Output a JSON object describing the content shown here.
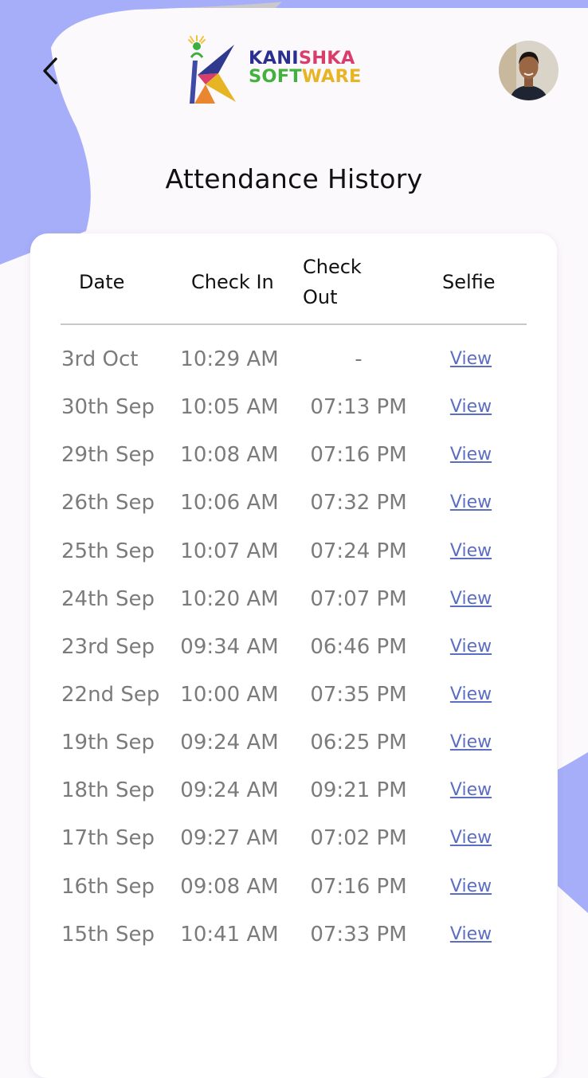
{
  "header": {
    "back_icon": "chevron-left-icon",
    "logo": {
      "line1_part1": "KANI",
      "line1_part2": "SHKA",
      "line2_part1": "SOFT",
      "line2_part2": "WARE"
    },
    "avatar": "profile-photo"
  },
  "page": {
    "title": "Attendance History"
  },
  "table": {
    "headers": {
      "date": "Date",
      "check_in": "Check In",
      "check_out": "Check Out",
      "selfie": "Selfie"
    },
    "rows": [
      {
        "date": "3rd Oct",
        "check_in": "10:29 AM",
        "check_out": "-",
        "selfie": "View"
      },
      {
        "date": "30th Sep",
        "check_in": "10:05 AM",
        "check_out": "07:13 PM",
        "selfie": "View"
      },
      {
        "date": "29th Sep",
        "check_in": "10:08 AM",
        "check_out": "07:16 PM",
        "selfie": "View"
      },
      {
        "date": "26th Sep",
        "check_in": "10:06 AM",
        "check_out": "07:32 PM",
        "selfie": "View"
      },
      {
        "date": "25th Sep",
        "check_in": "10:07 AM",
        "check_out": "07:24 PM",
        "selfie": "View"
      },
      {
        "date": "24th Sep",
        "check_in": "10:20 AM",
        "check_out": "07:07 PM",
        "selfie": "View"
      },
      {
        "date": "23rd Sep",
        "check_in": "09:34 AM",
        "check_out": "06:46 PM",
        "selfie": "View"
      },
      {
        "date": "22nd Sep",
        "check_in": "10:00 AM",
        "check_out": "07:35 PM",
        "selfie": "View"
      },
      {
        "date": "19th Sep",
        "check_in": "09:24 AM",
        "check_out": "06:25 PM",
        "selfie": "View"
      },
      {
        "date": "18th Sep",
        "check_in": "09:24 AM",
        "check_out": "09:21 PM",
        "selfie": "View"
      },
      {
        "date": "17th Sep",
        "check_in": "09:27 AM",
        "check_out": "07:02 PM",
        "selfie": "View"
      },
      {
        "date": "16th Sep",
        "check_in": "09:08 AM",
        "check_out": "07:16 PM",
        "selfie": "View"
      },
      {
        "date": "15th Sep",
        "check_in": "10:41 AM",
        "check_out": "07:33 PM",
        "selfie": "View"
      }
    ]
  },
  "colors": {
    "background": "#fcf9fd",
    "blob": "#a6aefa",
    "card": "#ffffff",
    "link": "#5b6ec2",
    "row_text": "#7b7b7b",
    "header_text": "#111111"
  }
}
